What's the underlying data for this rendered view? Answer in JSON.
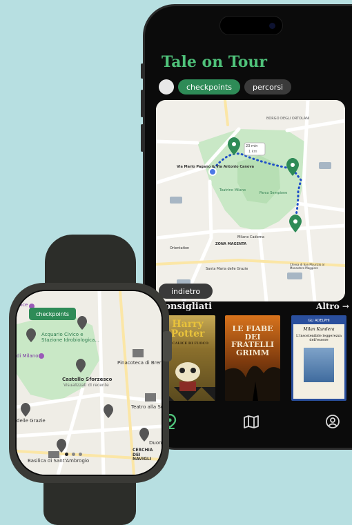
{
  "phone": {
    "app_title": "Tale on Tour",
    "segments": [
      {
        "label": "checkpoints",
        "active": true
      },
      {
        "label": "percorsi",
        "active": false
      }
    ],
    "map_back_label": "indietro",
    "map_labels": {
      "borgo": "BORGO DEGLI ORTOLANI",
      "route_start": "Via Mario Pagano & Via Antonio Canova",
      "time_badge": "23 min",
      "distance_badge": "1 km",
      "teatrino": "Teatrino Milano",
      "parco": "Parco Sempione",
      "zona": "ZONA MAGENTA",
      "cenacolo": "Milano Cadorna",
      "santa": "Santa Maria delle Grazie",
      "canova": "Orientation",
      "sanmaurizio": "Chiesa di San Maurizio al Monastero Maggiore"
    },
    "section_title": "Consigliati",
    "section_more": "Altro →",
    "books": [
      {
        "title": "Harry Potter",
        "series": "IL CALICE DI FUOCO"
      },
      {
        "title": "LE FIABE DEI FRATELLI GRIMM"
      },
      {
        "author": "Milan Kundera",
        "title": "L'insostenibile leggerezza dell'essere",
        "publisher": "GLI ADELPHI"
      }
    ],
    "tabs": [
      {
        "name": "map-pin",
        "active": true
      },
      {
        "name": "book-map",
        "active": false
      },
      {
        "name": "profile",
        "active": false
      }
    ],
    "accent_color": "#4fc27a"
  },
  "watch": {
    "chip_label": "checkpoints",
    "labels": {
      "pace": "Pace",
      "acquario": "Acquario Civico e Stazione Idrobiologica...",
      "milano": "di Milano",
      "pinacoteca": "Pinacoteca di Brera",
      "castello": "Castello Sforzesco",
      "castello_sub": "Visualizzati di recente",
      "teatro": "Teatro alla Sc",
      "grazie": "delle Grazie",
      "duomo": "Duon",
      "cerchia": "CERCHIA DEI NAVIGLI",
      "ambrogio": "Basilica di Sant'Ambrogio"
    },
    "page_count": 3,
    "page_index": 0
  }
}
